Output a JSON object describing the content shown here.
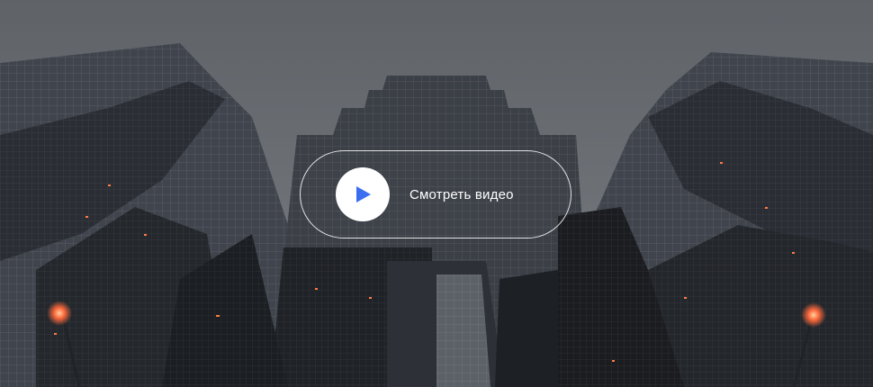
{
  "video_cta": {
    "label": "Смотреть видео",
    "icon": "play-icon",
    "icon_color": "#3b6df0"
  },
  "background": {
    "subject": "skyscrapers-looking-up",
    "sky_color": "#6b6f74",
    "glass_color": "#3a3f47",
    "light_color": "#ff6a3d"
  }
}
